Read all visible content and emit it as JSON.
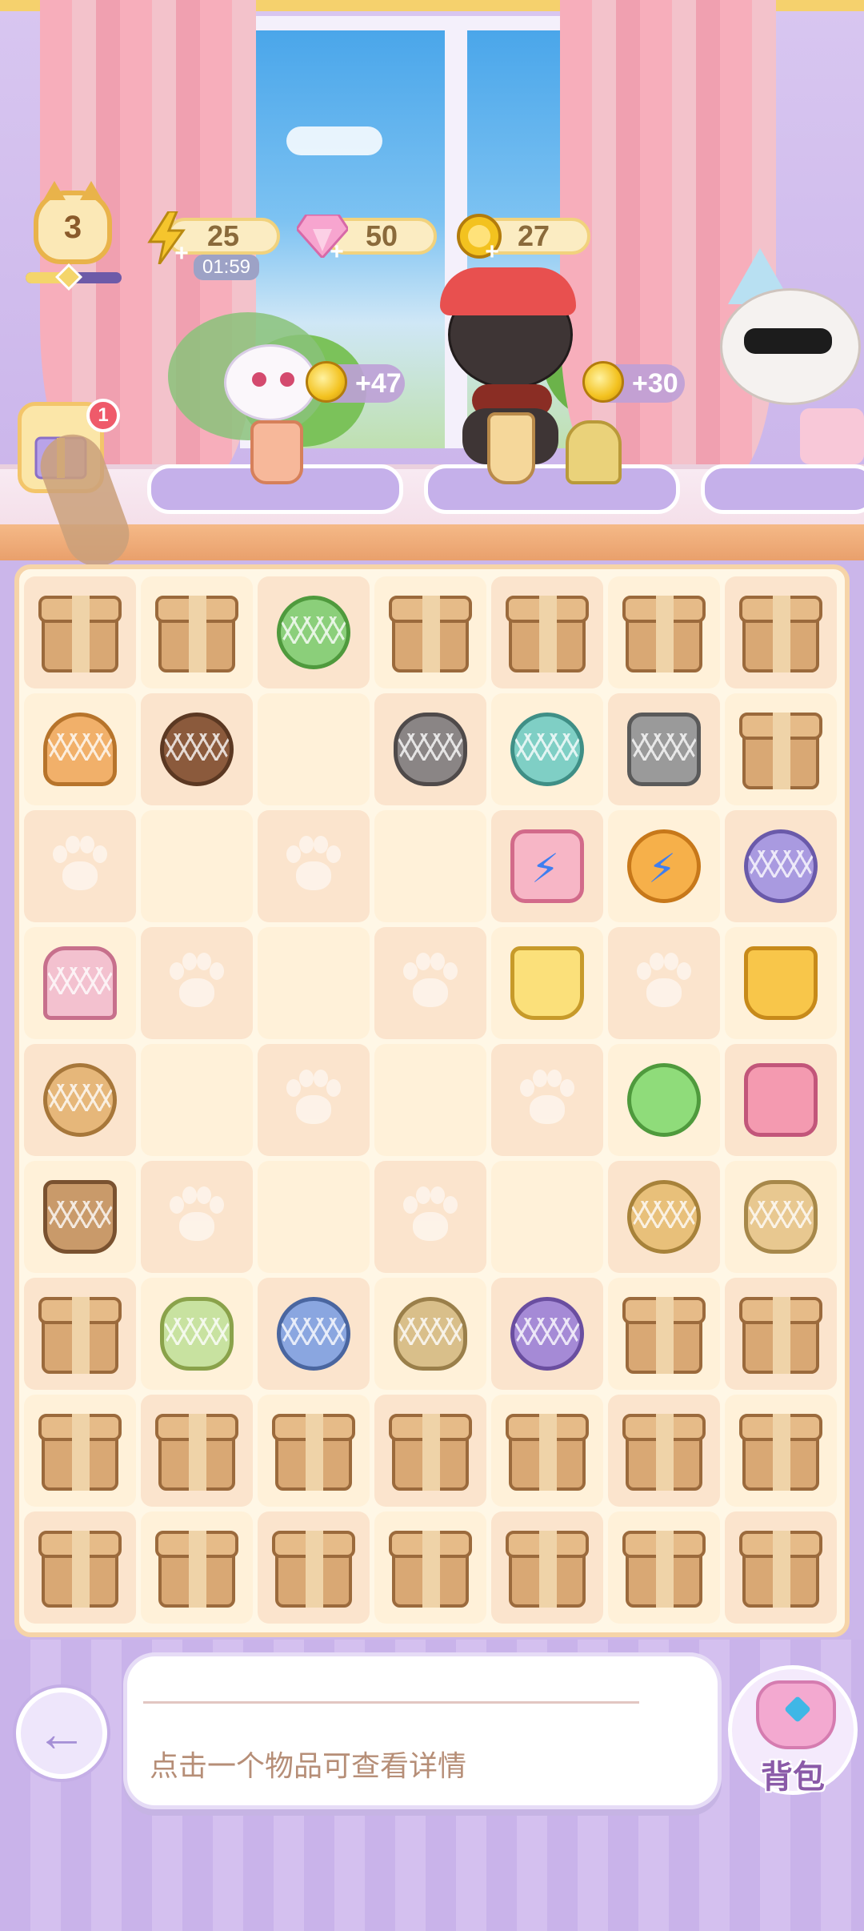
{
  "hud": {
    "level": "3",
    "xp_fraction": 0.45,
    "energy": {
      "value": "25",
      "timer": "01:59",
      "icon": "lightning-icon"
    },
    "gems": {
      "value": "50",
      "icon": "pink-gem-icon"
    },
    "coins": {
      "value": "27",
      "icon": "gold-coin-icon"
    }
  },
  "gift": {
    "badge": "1",
    "icon": "gift-icon"
  },
  "customers": [
    {
      "name": "white-cat",
      "reward": "+47",
      "order_items": [
        "peach-drink"
      ]
    },
    {
      "name": "black-cat",
      "reward": "+30",
      "order_items": [
        "parfait",
        "dress"
      ]
    },
    {
      "name": "sunglasses-cat",
      "reward": "",
      "order_items": [
        "pink-dress"
      ]
    }
  ],
  "board": {
    "columns": 7,
    "rows": 9,
    "cells": [
      [
        "box",
        "box",
        "watering-can",
        "box",
        "box",
        "box",
        "box"
      ],
      [
        "tulip",
        "brown-bowl",
        "empty",
        "gray-cat",
        "teal-bowl",
        "shovel",
        "box"
      ],
      [
        "empty",
        "empty",
        "empty",
        "empty",
        "energy-dress",
        "energy-cup",
        "hydrangea"
      ],
      [
        "pink-dress",
        "empty",
        "empty",
        "empty",
        "juice-cup",
        "empty",
        "mango-drink"
      ],
      [
        "cat-bun",
        "empty",
        "empty",
        "empty",
        "empty",
        "green-flower",
        "pink-bag"
      ],
      [
        "iced-coffee",
        "empty",
        "empty",
        "empty",
        "empty",
        "cream-puff",
        "fruit-cake"
      ],
      [
        "box",
        "strawberry-cake",
        "scrunchie",
        "bread",
        "purple-ball",
        "box",
        "box"
      ],
      [
        "box",
        "box",
        "box",
        "box",
        "box",
        "box",
        "box"
      ],
      [
        "box",
        "box",
        "box",
        "box",
        "box",
        "box",
        "box"
      ]
    ]
  },
  "info_panel": {
    "text": "点击一个物品可查看详情"
  },
  "bag_button": {
    "label": "背包"
  },
  "colors": {
    "accent": "#c9b3ea",
    "board": "#fff7e6",
    "box": "#d9a874",
    "coin": "#f3c21f"
  }
}
